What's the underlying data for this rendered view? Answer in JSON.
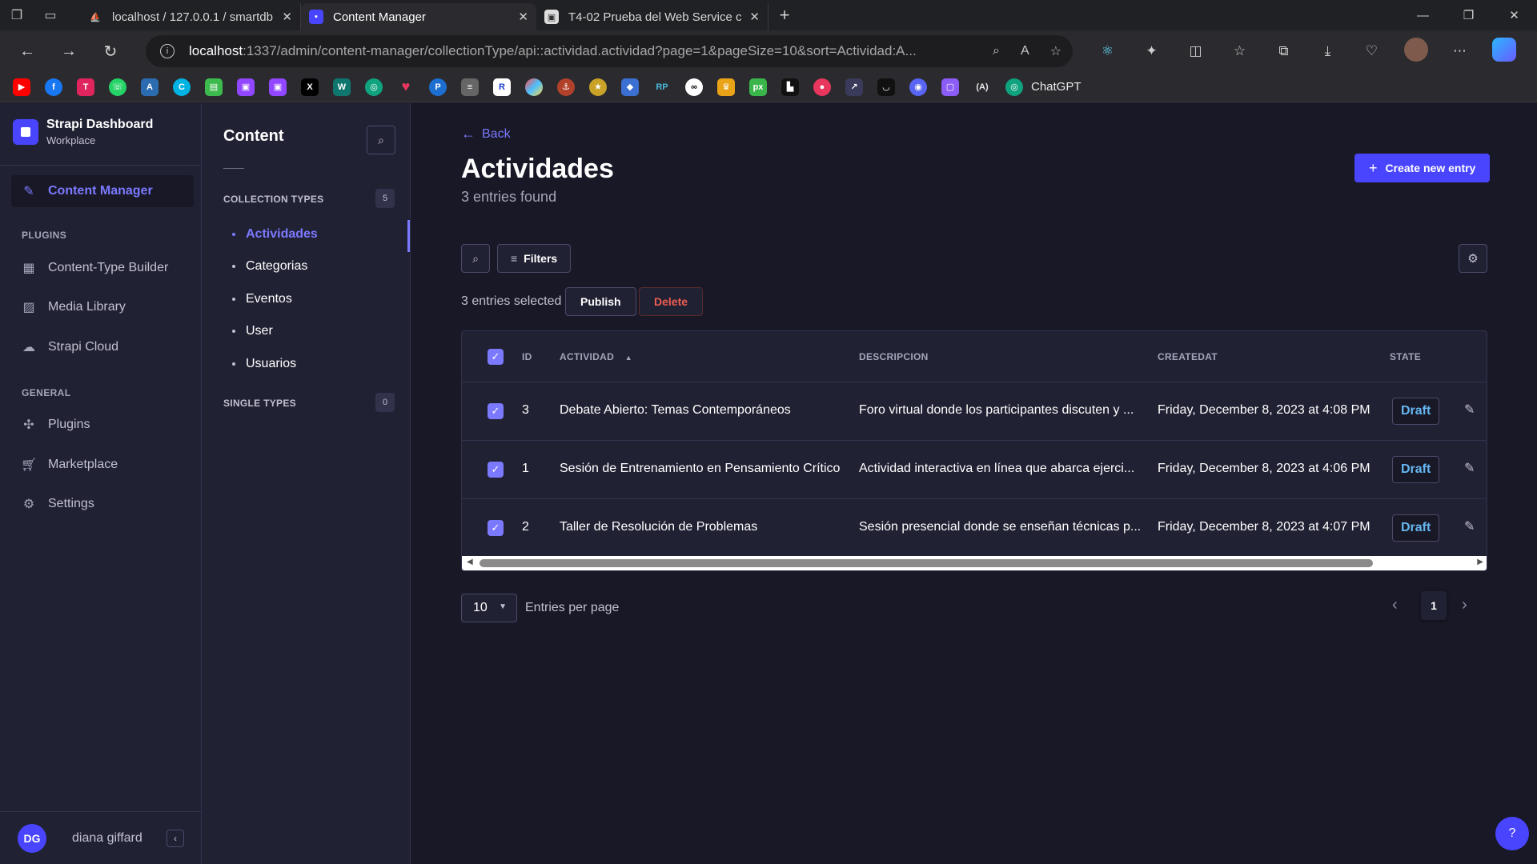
{
  "browser": {
    "tabs": [
      {
        "title": "localhost / 127.0.0.1 / smartdb / ",
        "active": false
      },
      {
        "title": "Content Manager",
        "active": true
      },
      {
        "title": "T4-02 Prueba del Web Service co",
        "active": false
      }
    ],
    "url_host": "localhost",
    "url_rest": ":1337/admin/content-manager/collectionType/api::actividad.actividad?page=1&pageSize=10&sort=Actividad:A...",
    "bookmark_label": "ChatGPT"
  },
  "sidebar": {
    "brand_title": "Strapi Dashboard",
    "brand_subtitle": "Workplace",
    "active_item": "Content Manager",
    "plugins_label": "PLUGINS",
    "plugins": [
      "Content-Type Builder",
      "Media Library",
      "Strapi Cloud"
    ],
    "general_label": "GENERAL",
    "general": [
      "Plugins",
      "Marketplace",
      "Settings"
    ],
    "user_initials": "DG",
    "user_name": "diana giffard"
  },
  "content_nav": {
    "title": "Content",
    "collection_label": "COLLECTION TYPES",
    "collection_count": "5",
    "collection_items": [
      "Actividades",
      "Categorias",
      "Eventos",
      "User",
      "Usuarios"
    ],
    "single_label": "SINGLE TYPES",
    "single_count": "0"
  },
  "main": {
    "back_label": "Back",
    "title": "Actividades",
    "subtitle": "3 entries found",
    "create_label": "Create new entry",
    "filters_label": "Filters",
    "selected_text": "3 entries selected",
    "publish_label": "Publish",
    "delete_label": "Delete",
    "columns": {
      "id": "ID",
      "actividad": "ACTIVIDAD",
      "descripcion": "DESCRIPCION",
      "createdat": "CREATEDAT",
      "state": "STATE"
    },
    "rows": [
      {
        "id": "3",
        "actividad": "Debate Abierto: Temas Contemporáneos",
        "descripcion": "Foro virtual donde los participantes discuten y ...",
        "createdat": "Friday, December 8, 2023 at 4:08 PM",
        "state": "Draft"
      },
      {
        "id": "1",
        "actividad": "Sesión de Entrenamiento en Pensamiento Crítico",
        "descripcion": "Actividad interactiva en línea que abarca ejerci...",
        "createdat": "Friday, December 8, 2023 at 4:06 PM",
        "state": "Draft"
      },
      {
        "id": "2",
        "actividad": "Taller de Resolución de Problemas",
        "descripcion": "Sesión presencial donde se enseñan técnicas p...",
        "createdat": "Friday, December 8, 2023 at 4:07 PM",
        "state": "Draft"
      }
    ],
    "per_page_value": "10",
    "per_page_label": "Entries per page",
    "current_page": "1"
  },
  "colors": {
    "accent": "#7b79ff",
    "primary": "#4945ff",
    "danger": "#ee5e52",
    "draft": "#66b7f1"
  }
}
